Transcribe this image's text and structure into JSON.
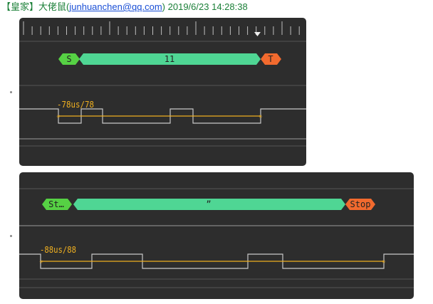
{
  "header": {
    "bracket_label": "【皇家】",
    "author": "大佬鼠",
    "email": "junhuanchen@qq.com",
    "datetime": "2019/6/23 14:28:38"
  },
  "capture1": {
    "start_marker": "S",
    "data_value": "11",
    "stop_marker": "T",
    "timing_label": "-78us/78",
    "waveform_levels": [
      1,
      0,
      1,
      0,
      1,
      0
    ]
  },
  "capture2": {
    "start_marker": "St…",
    "data_value": "”",
    "stop_marker": "Stop",
    "timing_label": "-88us/88",
    "waveform_levels": [
      1,
      0,
      1,
      0,
      1,
      0,
      1
    ]
  },
  "colors": {
    "panel_bg": "#2d2d2d",
    "frame_bar": "#4fd694",
    "start_marker": "#56d144",
    "stop_marker": "#f26a2e",
    "signal_line": "#c8c8c8",
    "cursor_line": "#f0b020"
  },
  "icons": {
    "trigger": "trigger-marker-icon"
  }
}
